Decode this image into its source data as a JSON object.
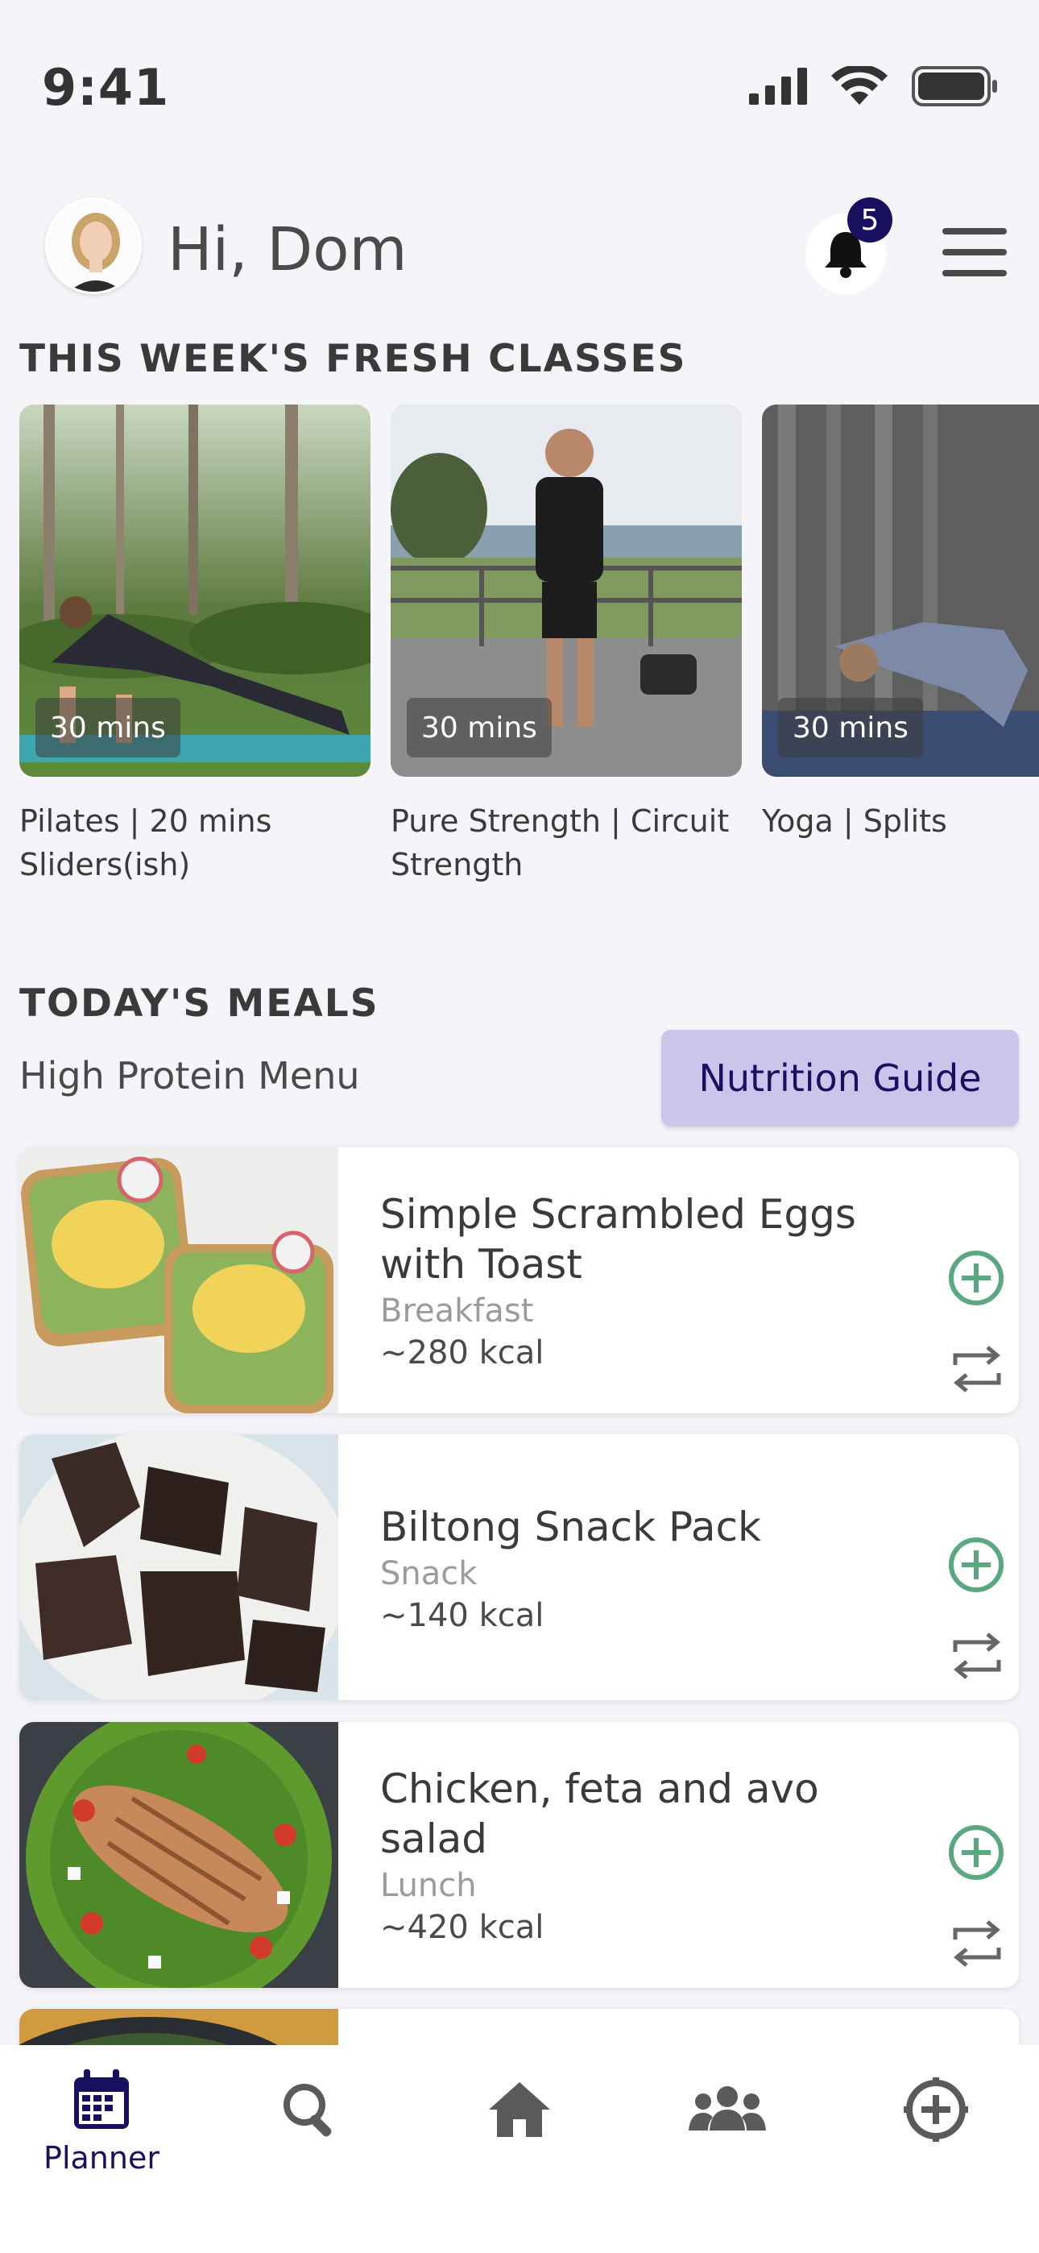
{
  "status": {
    "time": "9:41"
  },
  "header": {
    "greeting": "Hi, Dom",
    "notification_count": "5"
  },
  "classes_section": {
    "title": "THIS WEEK'S FRESH CLASSES",
    "items": [
      {
        "duration": "30 mins",
        "title": "Pilates | 20 mins Sliders(ish)"
      },
      {
        "duration": "30 mins",
        "title": "Pure Strength | Circuit Strength"
      },
      {
        "duration": "30 mins",
        "title": "Yoga | Splits"
      }
    ]
  },
  "meals_section": {
    "title": "TODAY'S MEALS",
    "menu_name": "High Protein Menu",
    "nutrition_button": "Nutrition Guide",
    "items": [
      {
        "name": "Simple Scrambled Eggs with Toast",
        "type": "Breakfast",
        "kcal": "~280 kcal"
      },
      {
        "name": "Biltong Snack Pack",
        "type": "Snack",
        "kcal": "~140 kcal"
      },
      {
        "name": "Chicken, feta and avo salad",
        "type": "Lunch",
        "kcal": "~420 kcal"
      }
    ]
  },
  "bottom_nav": {
    "items": [
      {
        "label": "Planner",
        "icon": "calendar-icon",
        "active": true
      },
      {
        "label": "",
        "icon": "search-icon"
      },
      {
        "label": "",
        "icon": "home-icon"
      },
      {
        "label": "",
        "icon": "community-icon"
      },
      {
        "label": "",
        "icon": "add-circle-icon"
      }
    ]
  },
  "colors": {
    "accent": "#1a1060",
    "button_bg": "#cbc5ec",
    "add_icon": "#5aa880",
    "background": "#f5f4f9"
  }
}
